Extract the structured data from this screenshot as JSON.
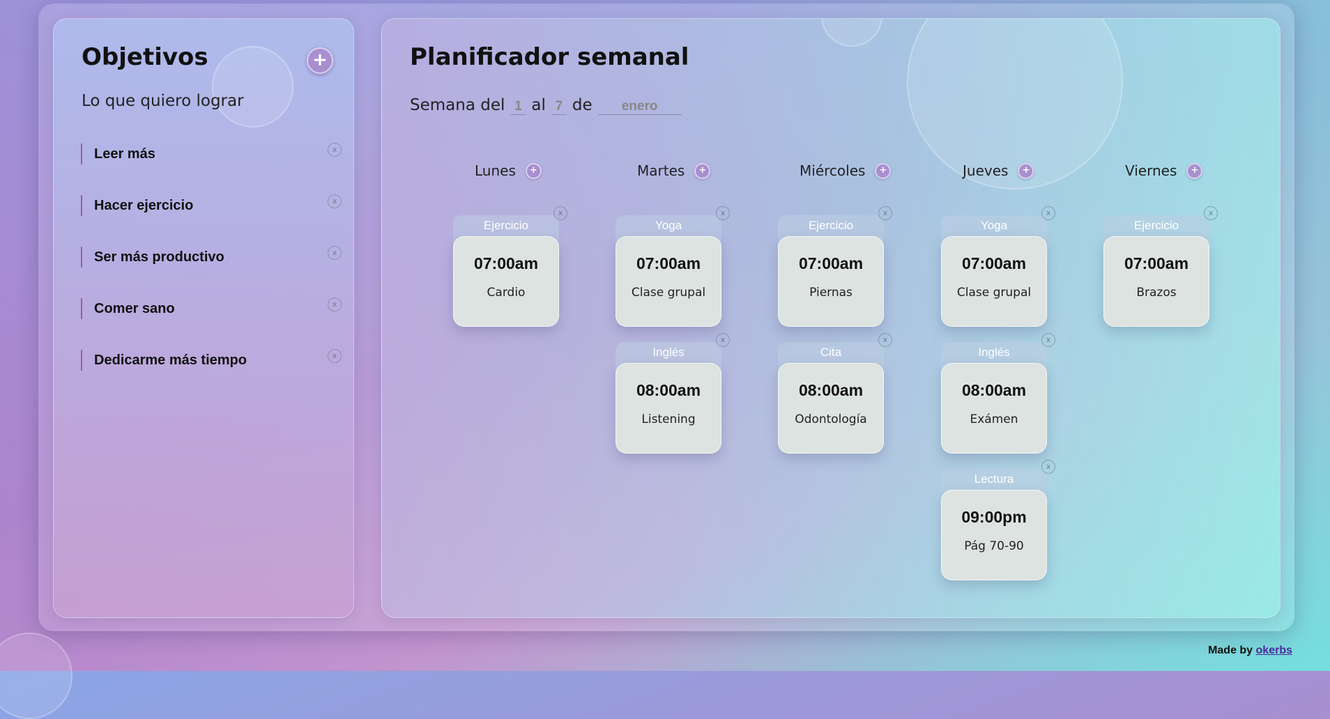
{
  "goals": {
    "title": "Objetivos",
    "subtitle": "Lo que quiero lograr",
    "add_label": "+",
    "items": [
      {
        "label": "Leer más"
      },
      {
        "label": "Hacer ejercicio"
      },
      {
        "label": "Ser más productivo"
      },
      {
        "label": "Comer sano"
      },
      {
        "label": "Dedicarme más tiempo"
      }
    ],
    "remove_label": "x"
  },
  "planner": {
    "title": "Planificador semanal",
    "week_prefix": "Semana del",
    "from_day": "1",
    "to_label": "al",
    "to_day": "7",
    "of_label": "de",
    "month": "enero",
    "add_label": "+",
    "remove_label": "x",
    "days": [
      {
        "name": "Lunes",
        "events": [
          {
            "category": "Ejercicio",
            "time": "07:00am",
            "desc": "Cardio"
          }
        ]
      },
      {
        "name": "Martes",
        "events": [
          {
            "category": "Yoga",
            "time": "07:00am",
            "desc": "Clase grupal"
          },
          {
            "category": "Inglés",
            "time": "08:00am",
            "desc": "Listening"
          }
        ]
      },
      {
        "name": "Miércoles",
        "events": [
          {
            "category": "Ejercicio",
            "time": "07:00am",
            "desc": "Piernas"
          },
          {
            "category": "Cita",
            "time": "08:00am",
            "desc": "Odontología"
          }
        ]
      },
      {
        "name": "Jueves",
        "events": [
          {
            "category": "Yoga",
            "time": "07:00am",
            "desc": "Clase grupal"
          },
          {
            "category": "Inglés",
            "time": "08:00am",
            "desc": "Exámen"
          },
          {
            "category": "Lectura",
            "time": "09:00pm",
            "desc": "Pág 70-90"
          }
        ]
      },
      {
        "name": "Viernes",
        "events": [
          {
            "category": "Ejercicio",
            "time": "07:00am",
            "desc": "Brazos"
          }
        ]
      }
    ]
  },
  "footer": {
    "prefix": "Made by",
    "author": "okerbs"
  },
  "colors": {
    "accent": "#a88fd0",
    "card": "#dde3e0",
    "goal_bar": "#9b5f9b"
  }
}
